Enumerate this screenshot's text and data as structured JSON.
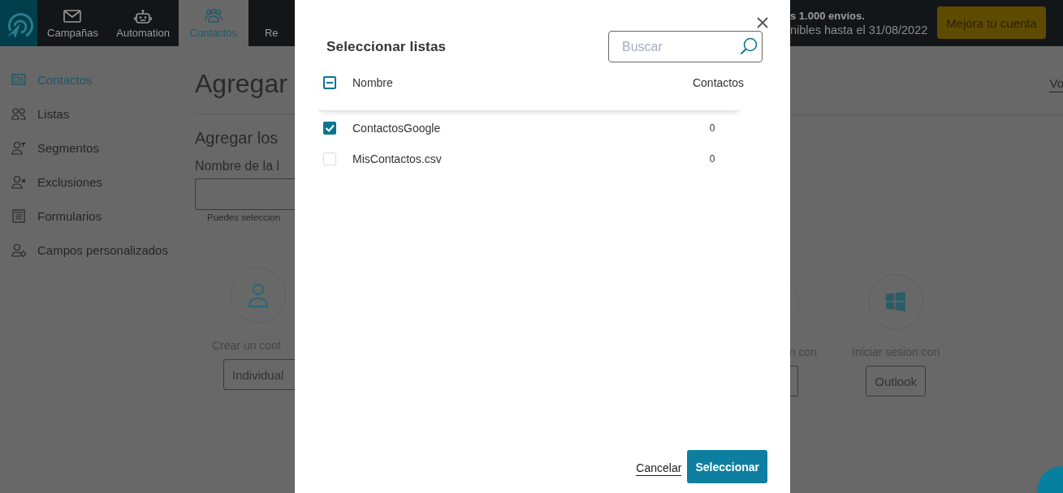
{
  "topbar": {
    "nav": [
      {
        "label": "Campañas",
        "selected": false
      },
      {
        "label": "Automation",
        "selected": false
      },
      {
        "label": "Contactos",
        "selected": true
      },
      {
        "label": "Re",
        "selected": false
      }
    ],
    "promo": {
      "line1": "s 1.000 envíos.",
      "line2": "nibles hasta el 31/08/2022",
      "button": "Mejora tu cuenta"
    }
  },
  "sidebar": {
    "items": [
      {
        "label": "Contactos",
        "selected": true
      },
      {
        "label": "Listas",
        "selected": false
      },
      {
        "label": "Segmentos",
        "selected": false
      },
      {
        "label": "Exclusiones",
        "selected": false
      },
      {
        "label": "Formularios",
        "selected": false
      },
      {
        "label": "Campos personalizados",
        "selected": false
      }
    ]
  },
  "page": {
    "title": "Agregar",
    "link": "Vo",
    "subtitle": "Agregar los",
    "field_label": "Nombre de la l",
    "field_hint": "Puedes seleccion",
    "options": [
      {
        "caption": "Crear un cont",
        "button": "Individual"
      },
      {
        "caption": "n con"
      },
      {
        "caption": "Iniciar sesion con",
        "button": "Outlook"
      }
    ]
  },
  "dialog": {
    "title": "Seleccionar listas",
    "search": {
      "placeholder": "Buscar"
    },
    "select_all": {
      "indeterminate": true
    },
    "columns": [
      "Nombre",
      "Contactos"
    ],
    "rows": [
      {
        "name": "ContactosGoogle",
        "count": "0",
        "checked": true
      },
      {
        "name": "MisContactos.csv",
        "count": "0",
        "checked": false
      }
    ],
    "cancel": "Cancelar",
    "confirm": "Seleccionar"
  }
}
